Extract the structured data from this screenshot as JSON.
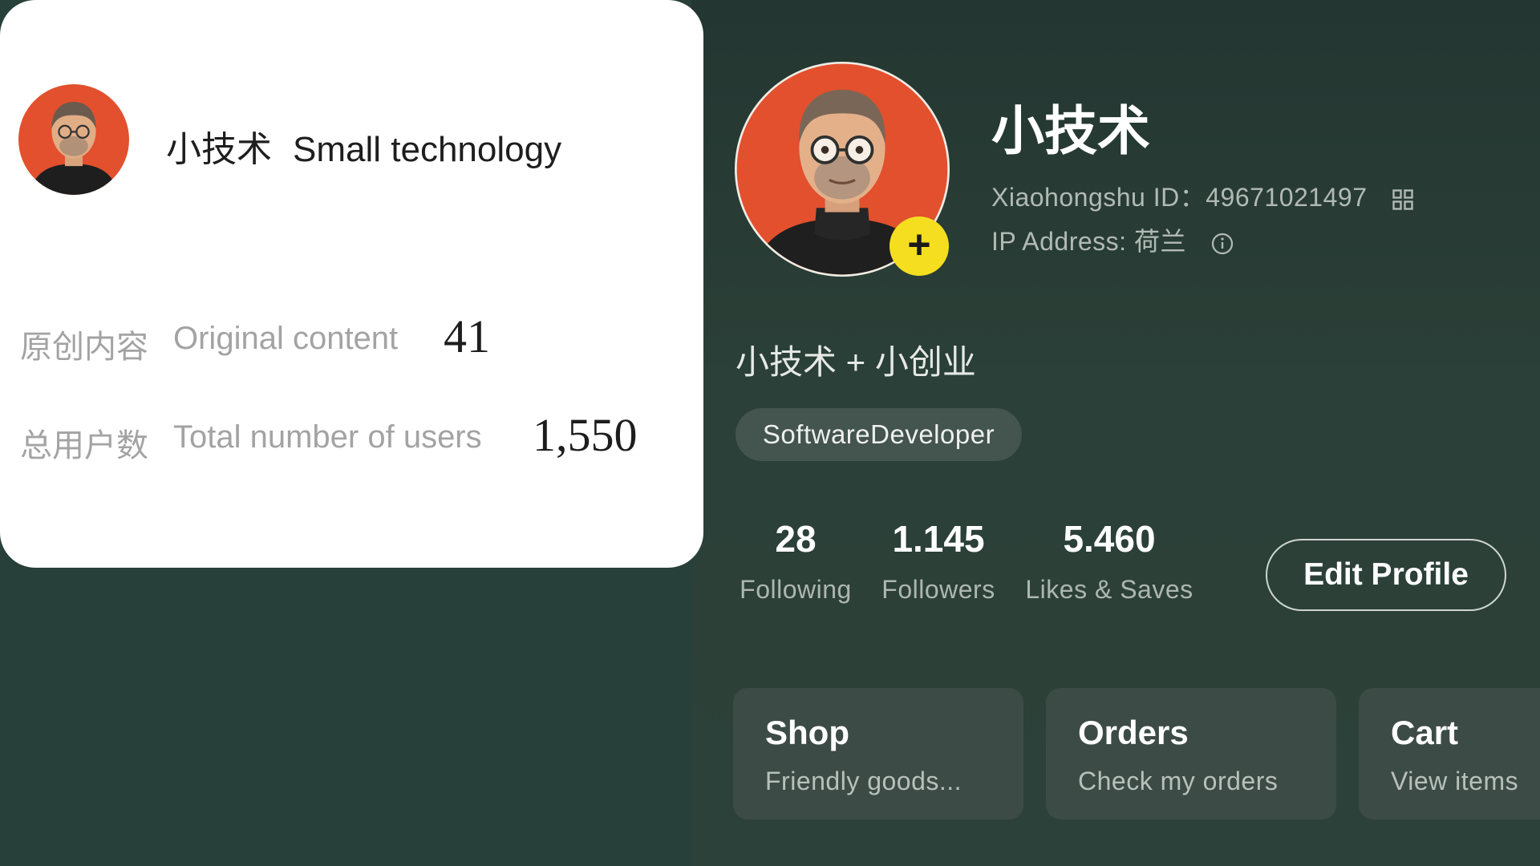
{
  "summary_card": {
    "name_cn": "小技术",
    "name_en": "Small technology",
    "rows": [
      {
        "label_cn": "原创内容",
        "label_en": "Original content",
        "value": "41"
      },
      {
        "label_cn": "总用户数",
        "label_en": "Total number of users",
        "value": "1,550"
      }
    ]
  },
  "profile": {
    "name": "小技术",
    "id_line": "Xiaohongshu ID：49671021497",
    "ip_line": "IP Address: 荷兰",
    "bio": "小技术 + 小创业",
    "tag": "SoftwareDeveloper",
    "stats": [
      {
        "value": "28",
        "label": "Following"
      },
      {
        "value": "1.145",
        "label": "Followers"
      },
      {
        "value": "5.460",
        "label": "Likes & Saves"
      }
    ],
    "edit_button": "Edit Profile"
  },
  "tiles": [
    {
      "title": "Shop",
      "subtitle": "Friendly goods..."
    },
    {
      "title": "Orders",
      "subtitle": "Check my orders"
    },
    {
      "title": "Cart",
      "subtitle": "View items"
    }
  ],
  "colors": {
    "background": "#28403a",
    "avatar_bg": "#e2502e",
    "plus_button": "#f5de20",
    "tile_bg": "#3c4b45"
  },
  "icons": [
    "plus-icon",
    "qr-code-icon",
    "info-icon"
  ]
}
